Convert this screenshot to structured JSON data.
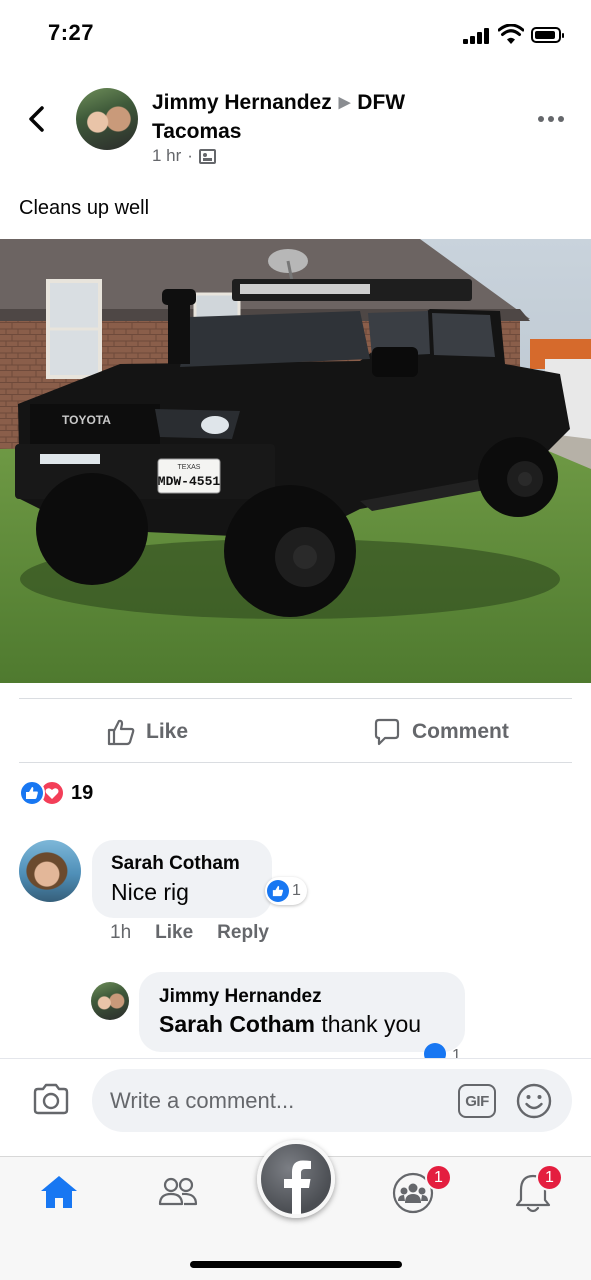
{
  "status_bar": {
    "time": "7:27"
  },
  "post": {
    "author": "Jimmy Hernandez",
    "group": "DFW Tacomas",
    "time": "1 hr",
    "text": "Cleans up well",
    "photo": {
      "plate_state": "TEXAS",
      "plate_number": "MDW-4551",
      "brand": "TOYOTA"
    }
  },
  "actions": {
    "like_label": "Like",
    "comment_label": "Comment"
  },
  "reactions": {
    "count": "19"
  },
  "comments": [
    {
      "name": "Sarah Cotham",
      "text": "Nice rig",
      "time": "1h",
      "like_label": "Like",
      "reply_label": "Reply",
      "reaction_count": "1"
    }
  ],
  "replies": [
    {
      "name": "Jimmy Hernandez",
      "mention": "Sarah Cotham",
      "text": "thank you",
      "reaction_count": "1"
    }
  ],
  "composer": {
    "placeholder": "Write a comment...",
    "gif_label": "GIF"
  },
  "tabbar": {
    "items": [
      "home-icon",
      "friends-icon",
      "facebook-icon",
      "groups-icon",
      "notifications-icon"
    ],
    "groups_badge": "1",
    "notifications_badge": "1"
  },
  "colors": {
    "accent": "#1877f2",
    "badge": "#e41e3f",
    "love": "#f33e58",
    "secondary_text": "#65676b"
  }
}
